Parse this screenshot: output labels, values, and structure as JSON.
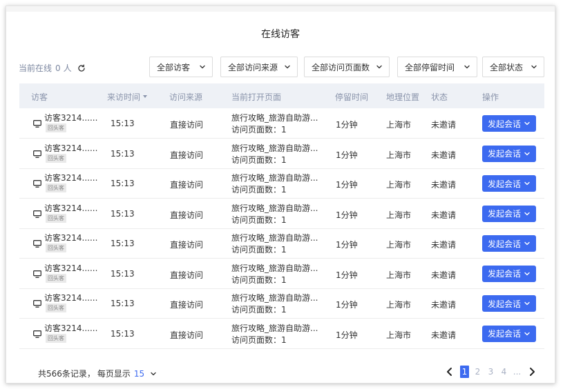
{
  "page": {
    "title": "在线访客",
    "online_label": "当前在线",
    "online_count": "0",
    "online_unit": "人"
  },
  "filters": [
    {
      "label": "全部访客"
    },
    {
      "label": "全部访问来源"
    },
    {
      "label": "全部访问页面数"
    },
    {
      "label": "全部停留时间"
    },
    {
      "label": "全部状态"
    }
  ],
  "table": {
    "headers": {
      "visitor": "访客",
      "visit_time": "来访时间",
      "source": "访问来源",
      "page": "当前打开页面",
      "duration": "停留时间",
      "location": "地理位置",
      "status": "状态",
      "action": "操作"
    },
    "rows": [
      {
        "name": "访客3214......",
        "tag": "回头客",
        "time": "15:13",
        "source": "直接访问",
        "page": "旅行攻略_旅游自助游...",
        "page_count": "访问页面数：1",
        "duration": "1分钟",
        "location": "上海市",
        "status": "未邀请",
        "action": "发起会话"
      },
      {
        "name": "访客3214......",
        "tag": "回头客",
        "time": "15:13",
        "source": "直接访问",
        "page": "旅行攻略_旅游自助游...",
        "page_count": "访问页面数：1",
        "duration": "1分钟",
        "location": "上海市",
        "status": "未邀请",
        "action": "发起会话"
      },
      {
        "name": "访客3214......",
        "tag": "回头客",
        "time": "15:13",
        "source": "直接访问",
        "page": "旅行攻略_旅游自助游...",
        "page_count": "访问页面数：1",
        "duration": "1分钟",
        "location": "上海市",
        "status": "未邀请",
        "action": "发起会话"
      },
      {
        "name": "访客3214......",
        "tag": "回头客",
        "time": "15:13",
        "source": "直接访问",
        "page": "旅行攻略_旅游自助游...",
        "page_count": "访问页面数：1",
        "duration": "1分钟",
        "location": "上海市",
        "status": "未邀请",
        "action": "发起会话"
      },
      {
        "name": "访客3214......",
        "tag": "回头客",
        "time": "15:13",
        "source": "直接访问",
        "page": "旅行攻略_旅游自助游...",
        "page_count": "访问页面数：1",
        "duration": "1分钟",
        "location": "上海市",
        "status": "未邀请",
        "action": "发起会话"
      },
      {
        "name": "访客3214......",
        "tag": "回头客",
        "time": "15:13",
        "source": "直接访问",
        "page": "旅行攻略_旅游自助游...",
        "page_count": "访问页面数：1",
        "duration": "1分钟",
        "location": "上海市",
        "status": "未邀请",
        "action": "发起会话"
      },
      {
        "name": "访客3214......",
        "tag": "回头客",
        "time": "15:13",
        "source": "直接访问",
        "page": "旅行攻略_旅游自助游...",
        "page_count": "访问页面数：1",
        "duration": "1分钟",
        "location": "上海市",
        "status": "未邀请",
        "action": "发起会话"
      },
      {
        "name": "访客3214......",
        "tag": "回头客",
        "time": "15:13",
        "source": "直接访问",
        "page": "旅行攻略_旅游自助游...",
        "page_count": "访问页面数：1",
        "duration": "1分钟",
        "location": "上海市",
        "status": "未邀请",
        "action": "发起会话"
      }
    ]
  },
  "footer": {
    "total": "共566条记录，",
    "per_page_label": "每页显示",
    "page_size": "15",
    "pages": [
      "1",
      "2",
      "3",
      "4",
      "..."
    ],
    "current_page": "1"
  },
  "icons": {
    "refresh": "refresh-icon",
    "chevron": "chevron-down-icon",
    "monitor": "monitor-icon",
    "sort": "sort-down-icon",
    "prev": "chevron-left-icon",
    "next": "chevron-right-icon"
  },
  "colors": {
    "accent": "#3c6af0",
    "header_bg": "#eef1f6",
    "muted_text": "#8a94ab"
  }
}
